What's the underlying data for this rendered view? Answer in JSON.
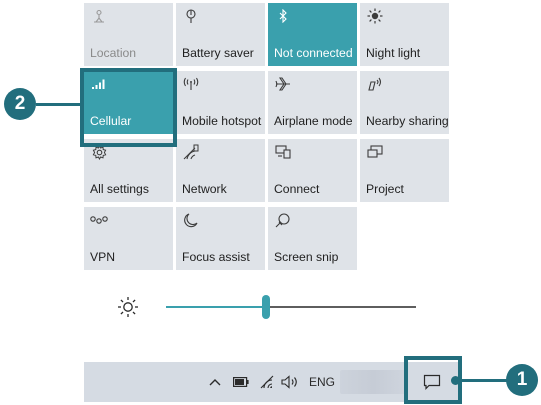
{
  "tiles": [
    {
      "label": "Location",
      "icon": "location-icon",
      "state": "dim"
    },
    {
      "label": "Battery saver",
      "icon": "battery-saver-icon",
      "state": "off"
    },
    {
      "label": "Not connected",
      "icon": "bluetooth-icon",
      "state": "on"
    },
    {
      "label": "Night light",
      "icon": "night-light-icon",
      "state": "off"
    },
    {
      "label": "Cellular",
      "icon": "cellular-signal-icon",
      "state": "on"
    },
    {
      "label": "Mobile hotspot",
      "icon": "mobile-hotspot-icon",
      "state": "off"
    },
    {
      "label": "Airplane mode",
      "icon": "airplane-icon",
      "state": "off"
    },
    {
      "label": "Nearby sharing",
      "icon": "nearby-sharing-icon",
      "state": "off"
    },
    {
      "label": "All settings",
      "icon": "gear-icon",
      "state": "off"
    },
    {
      "label": "Network",
      "icon": "network-icon",
      "state": "off"
    },
    {
      "label": "Connect",
      "icon": "connect-icon",
      "state": "off"
    },
    {
      "label": "Project",
      "icon": "project-icon",
      "state": "off"
    },
    {
      "label": "VPN",
      "icon": "vpn-icon",
      "state": "off"
    },
    {
      "label": "Focus assist",
      "icon": "moon-icon",
      "state": "off"
    },
    {
      "label": "Screen snip",
      "icon": "screen-snip-icon",
      "state": "off"
    }
  ],
  "brightness": {
    "icon": "brightness-sun-icon",
    "level": 0.4
  },
  "taskbar": {
    "icons": [
      "chevron-up-icon",
      "battery-icon",
      "wifi-icon",
      "speaker-icon"
    ],
    "language": "ENG",
    "action_center_icon": "action-center-icon"
  },
  "callouts": {
    "one": "1",
    "two": "2"
  },
  "colors": {
    "accent": "#3aa0ad",
    "tile": "#dfe3e8",
    "callout": "#226e7d",
    "taskbar": "#d5dbe3"
  }
}
